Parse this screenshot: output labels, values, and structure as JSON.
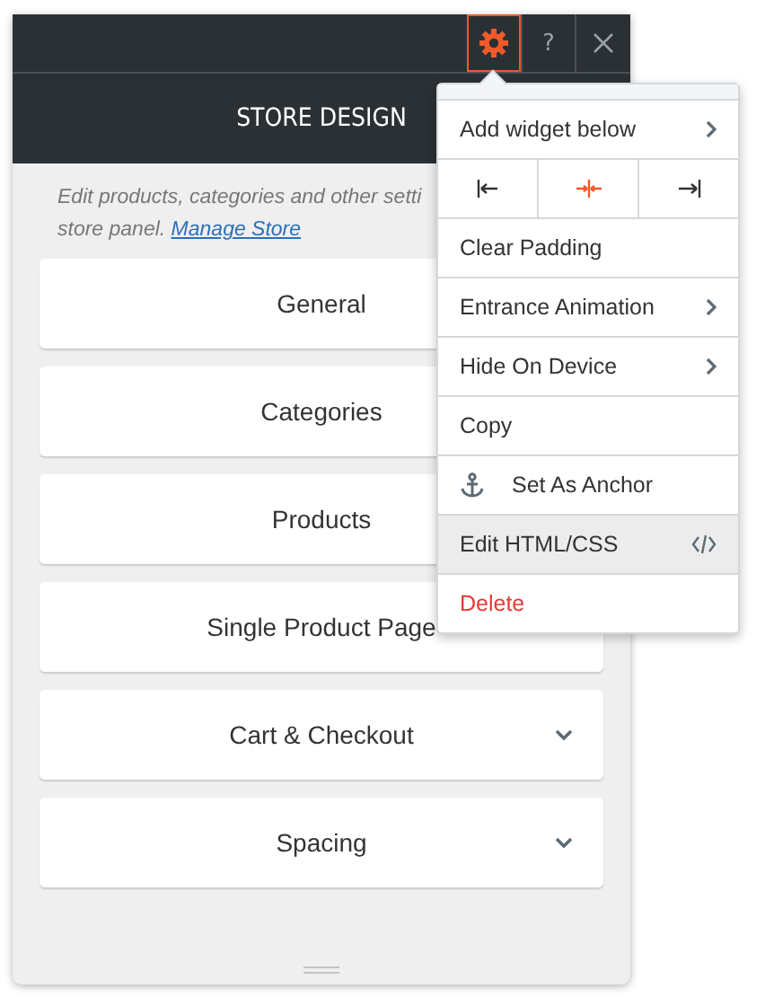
{
  "toolbar": {
    "settings_active": true,
    "help": "?"
  },
  "panel": {
    "title": "STORE DESIGN",
    "description": [
      "Edit products, categories and other setti",
      "store panel. "
    ],
    "link": "Manage Store",
    "sections": [
      {
        "label": "General"
      },
      {
        "label": "Categories"
      },
      {
        "label": "Products"
      },
      {
        "label": "Single Product Page"
      },
      {
        "label": "Cart & Checkout",
        "chevron": true
      },
      {
        "label": "Spacing",
        "chevron": true
      }
    ]
  },
  "menu": {
    "items": [
      {
        "kind": "submenu",
        "label": "Add widget below",
        "selected": false
      },
      {
        "kind": "align",
        "options": [
          {
            "kind": "left",
            "selected": false
          },
          {
            "kind": "center",
            "selected": true
          },
          {
            "kind": "right",
            "selected": false
          }
        ]
      },
      {
        "kind": "plain",
        "label": "Clear Padding",
        "selected": false
      },
      {
        "kind": "submenu",
        "label": "Entrance Animation",
        "selected": false
      },
      {
        "kind": "submenu",
        "label": "Hide On Device",
        "selected": false
      },
      {
        "kind": "plain",
        "label": "Copy",
        "selected": false
      },
      {
        "kind": "anchor",
        "label": "Set As Anchor",
        "selected": false
      },
      {
        "kind": "code",
        "label": "Edit HTML/CSS",
        "selected": true
      },
      {
        "kind": "danger",
        "label": "Delete",
        "selected": false
      }
    ]
  }
}
